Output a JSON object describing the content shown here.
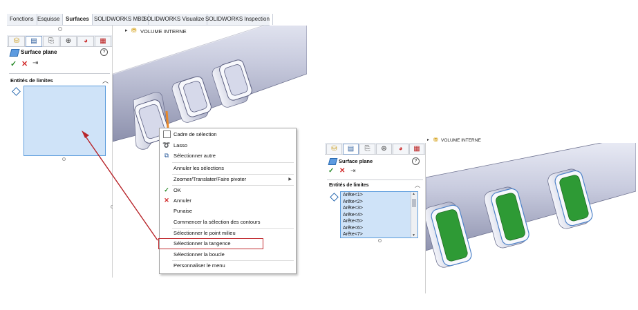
{
  "left": {
    "top_tabs": [
      "Fonctions",
      "Esquisse",
      "Surfaces",
      "SOLIDWORKS MBD",
      "SOLIDWORKS Visualize",
      "SOLIDWORKS Inspection"
    ],
    "active_tab": "Surfaces",
    "feature_title": "Surface plane",
    "section_label": "Entités de limites",
    "tree_item": "VOLUME INTERNE",
    "menu": {
      "items": [
        "Cadre de sélection",
        "Lasso",
        "Sélectionner autre",
        "Annuler les sélections",
        "Zoomer/Translater/Faire pivoter",
        "OK",
        "Annuler",
        "Punaise",
        "Commencer la sélection des contours",
        "Sélectionner le point milieu",
        "Sélectionner la tangence",
        "Sélectionner la boucle",
        "Personnaliser le menu"
      ],
      "highlighted": "Sélectionner la tangence"
    }
  },
  "right": {
    "feature_title": "Surface plane",
    "section_label": "Entités de limites",
    "tree_item": "VOLUME INTERNE",
    "edges": [
      "Arête<1>",
      "Arête<2>",
      "Arête<3>",
      "Arête<4>",
      "Arête<5>",
      "Arête<6>",
      "Arête<7>"
    ]
  },
  "colors": {
    "accent": "#c0282d",
    "selection": "#cfe3f8",
    "pipe": "#c6c9dc",
    "face": "#2e9a35"
  }
}
